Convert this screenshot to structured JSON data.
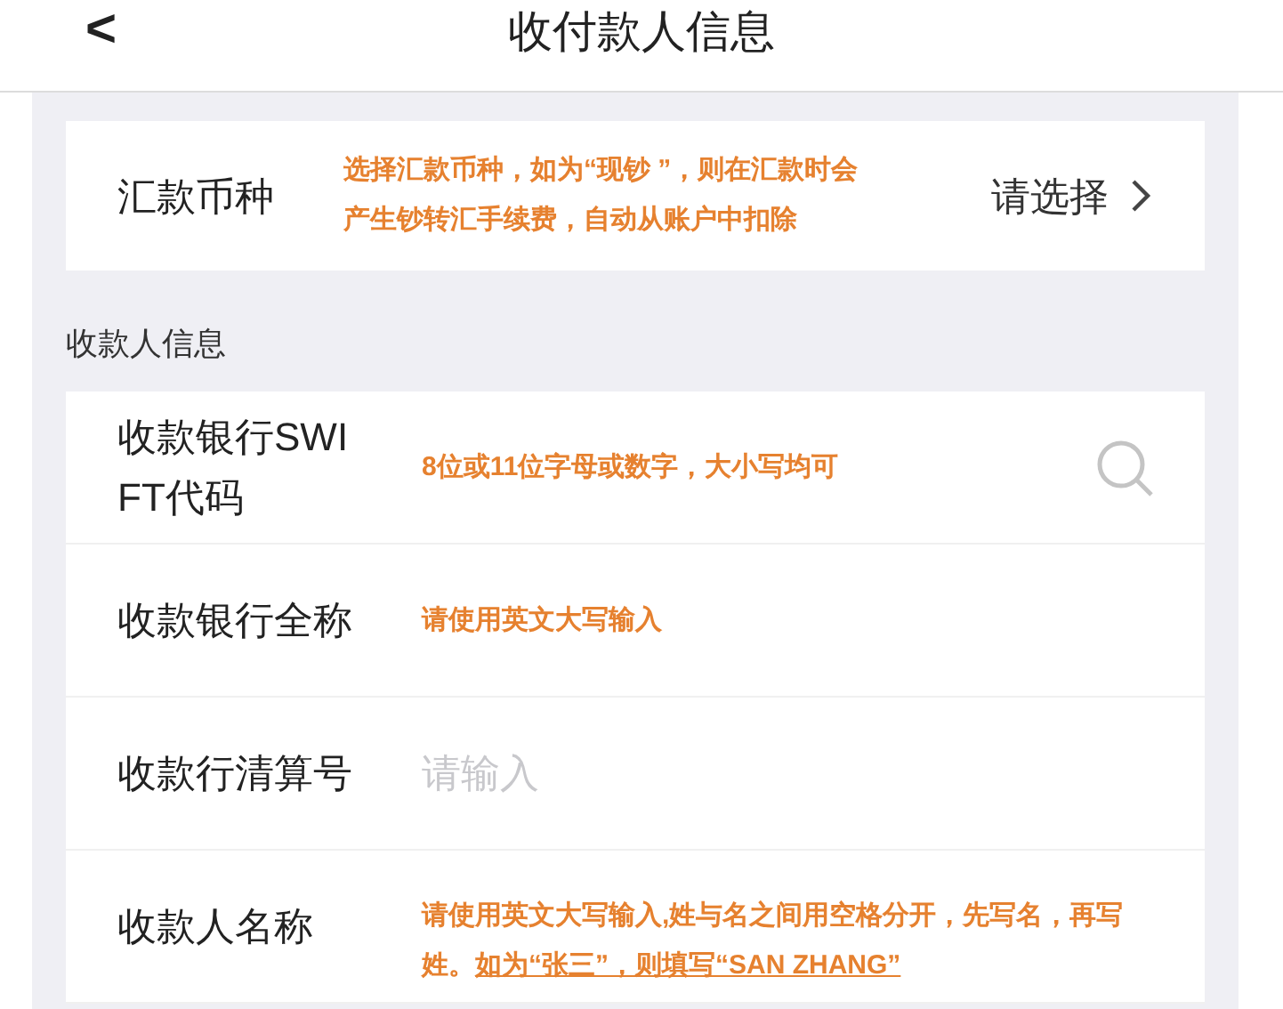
{
  "header": {
    "back": "<",
    "title": "收付款人信息"
  },
  "currency": {
    "label": "汇款币种",
    "note": "选择汇款币种，如为“现钞 ”，则在汇款时会产生钞转汇手续费，自动从账户中扣除",
    "value": "请选择"
  },
  "section_title": "收款人信息",
  "fields": [
    {
      "kind": "search",
      "label_lines": [
        "收款银行SWI",
        "FT代码"
      ],
      "note": "8位或11位字母或数字，大小写均可"
    },
    {
      "kind": "input",
      "label_lines": [
        "收款银行全称"
      ],
      "note": "请使用英文大写输入"
    },
    {
      "kind": "input",
      "label_lines": [
        "收款行清算号"
      ],
      "placeholder": "请输入"
    },
    {
      "kind": "input",
      "label_lines": [
        "收款人名称"
      ],
      "note": "请使用英文大写输入,姓与名之间用空格分开，先写名，再写姓。",
      "note_underlined": "如为“张三”，则填写“SAN  ZHANG”"
    }
  ]
}
